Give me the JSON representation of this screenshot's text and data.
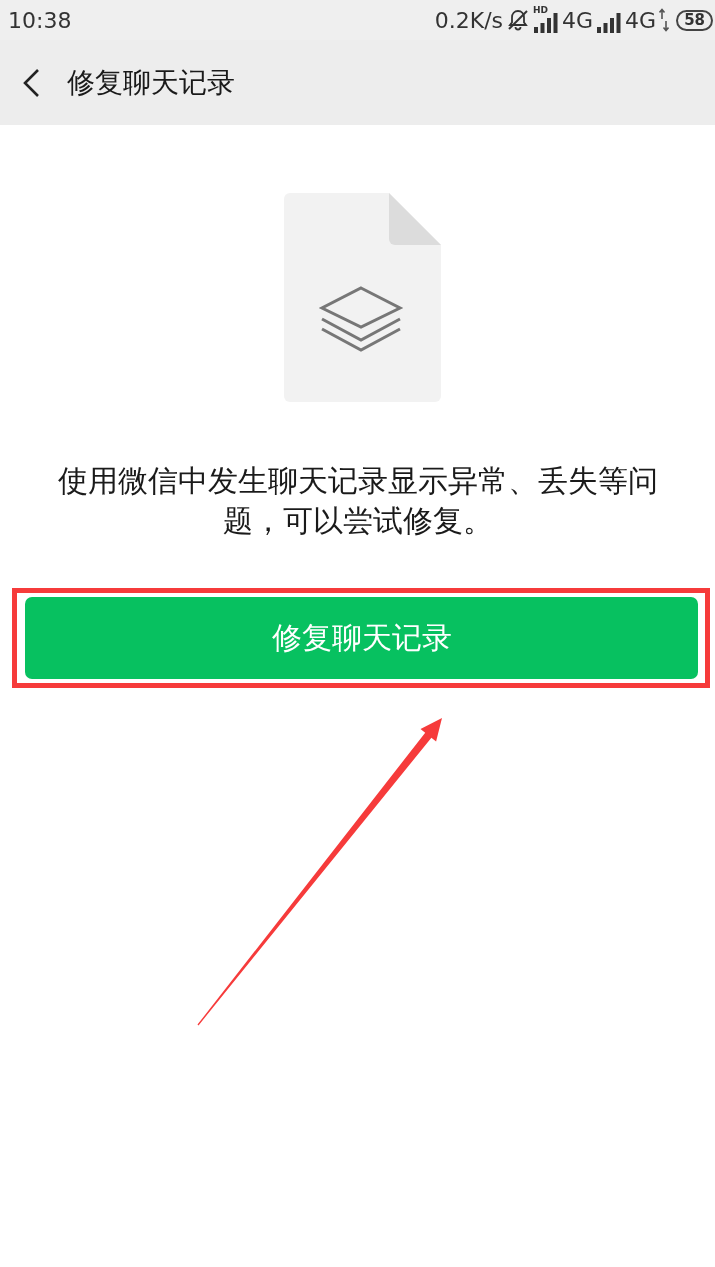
{
  "status_bar": {
    "time": "10:38",
    "speed": "0.2K/s",
    "muted": true,
    "networks": [
      {
        "hd_label": "HD",
        "label": "4G",
        "activity": false
      },
      {
        "label": "4G",
        "activity": true
      }
    ],
    "battery": "58"
  },
  "nav_bar": {
    "title": "修复聊天记录"
  },
  "content": {
    "description": "使用微信中发生聊天记录显示异常、丢失等问题，可以尝试修复。",
    "button": "修复聊天记录"
  },
  "annotations": {
    "button_frame": true,
    "pointer_arrow": true
  }
}
